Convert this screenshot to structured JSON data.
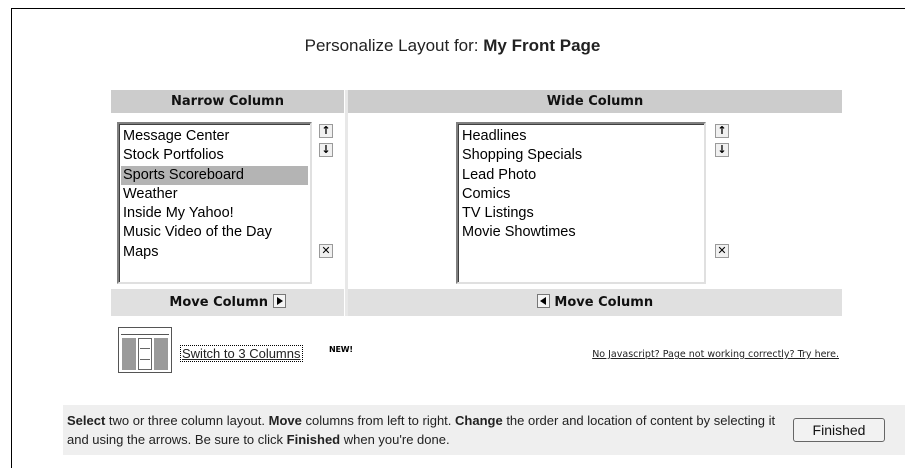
{
  "page": {
    "title_prefix": "Personalize Layout for:",
    "title_name": "My Front Page"
  },
  "narrow_column": {
    "header": "Narrow Column",
    "items": [
      "Message Center",
      "Stock Portfolios",
      "Sports Scoreboard",
      "Weather",
      "Inside My Yahoo!",
      "Music Video of the Day",
      "Maps"
    ],
    "selected": "Sports Scoreboard",
    "move_label": "Move Column"
  },
  "wide_column": {
    "header": "Wide Column",
    "items": [
      "Headlines",
      "Shopping Specials",
      "Lead Photo",
      "Comics",
      "TV Listings",
      "Movie Showtimes"
    ],
    "move_label": "Move Column"
  },
  "icons": {
    "up": "↑",
    "down": "↓",
    "remove": "✕"
  },
  "links": {
    "switch_columns": "Switch to 3 Columns",
    "new_badge": "NEW!",
    "no_javascript": "No Javascript? Page not working correctly? Try here."
  },
  "help": {
    "w1": "Select",
    "t1": " two or three column layout. ",
    "w2": "Move",
    "t2": " columns from left to right. ",
    "w3": "Change",
    "t3": " the order and location of content by selecting it and using the arrows. Be sure to click ",
    "w4": "Finished",
    "t4": " when you're done."
  },
  "buttons": {
    "finished": "Finished"
  },
  "colors": {
    "header_bg": "#cccccc",
    "footer_bg": "#e0e0e0",
    "selected_bg": "#b4b4b4",
    "help_bg": "#efefef"
  }
}
